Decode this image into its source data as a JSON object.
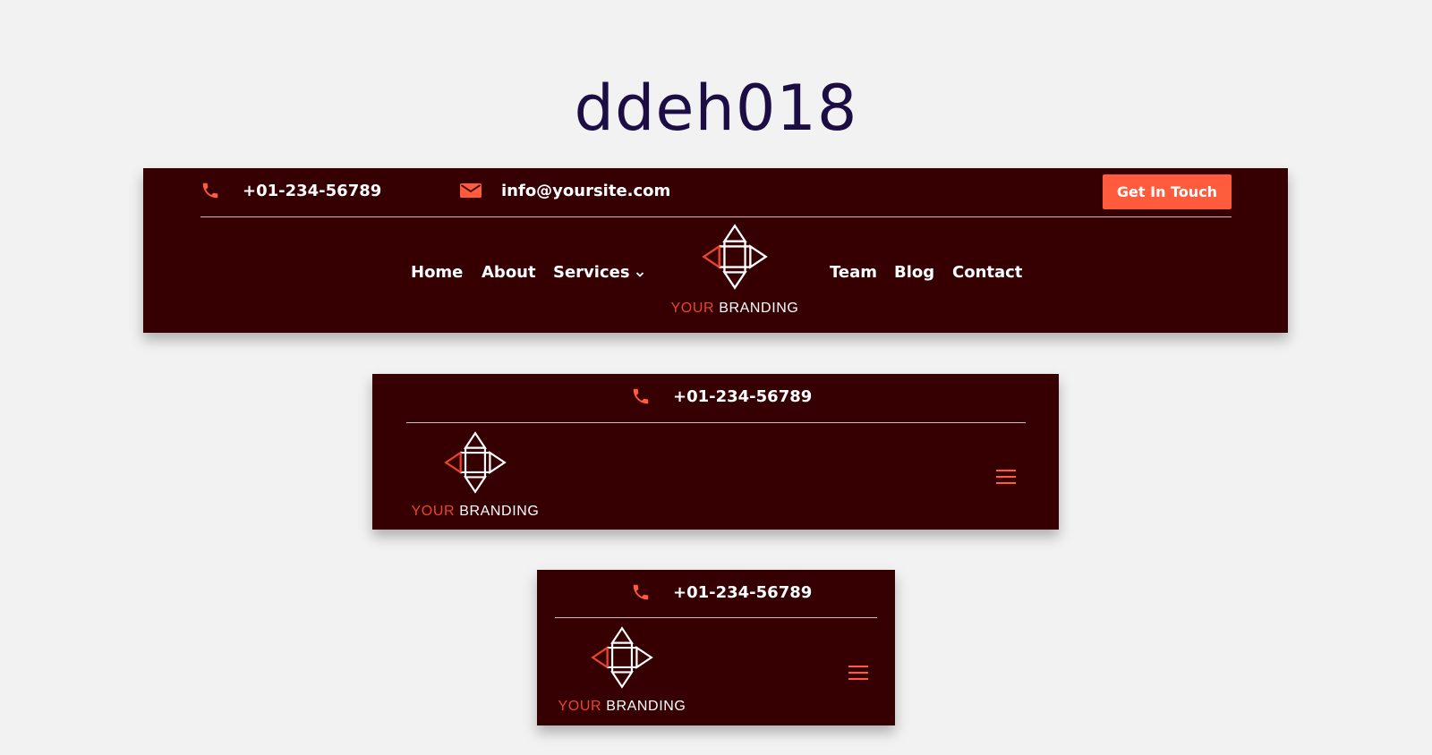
{
  "page": {
    "title": "ddeh018"
  },
  "contact": {
    "phone": "+01-234-56789",
    "email": "info@yoursite.com"
  },
  "cta": {
    "label": "Get In Touch"
  },
  "nav": {
    "left": [
      {
        "label": "Home"
      },
      {
        "label": "About"
      },
      {
        "label": "Services",
        "has_dropdown": true
      }
    ],
    "right": [
      {
        "label": "Team"
      },
      {
        "label": "Blog"
      },
      {
        "label": "Contact"
      }
    ]
  },
  "brand": {
    "accent_word": "YOUR",
    "rest_word": "BRANDING"
  },
  "icons": {
    "phone": "phone-icon",
    "email": "envelope-icon",
    "dropdown": "chevron-down-icon",
    "menu": "hamburger-menu-icon",
    "logo": "diamond-arrows-logo-icon"
  },
  "colors": {
    "page_bg": "#f2f2f2",
    "title": "#1c0e45",
    "header_bg": "#360003",
    "accent": "#ff5b3c",
    "logo_accent": "#e8452c",
    "text": "#ffffff"
  }
}
